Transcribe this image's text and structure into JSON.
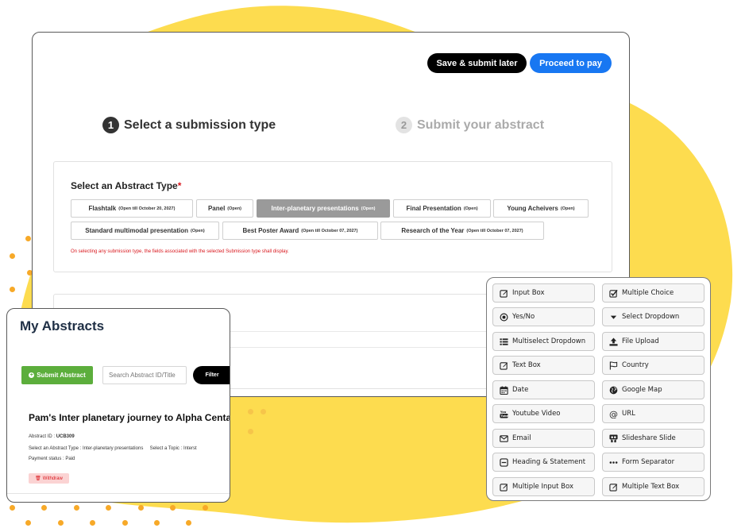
{
  "colors": {
    "accent_blue": "#1877f2",
    "submit_green": "#5cae3c",
    "required_red": "#d9181e",
    "blob_yellow": "#fddc4f"
  },
  "header": {
    "save_label": "Save & submit later",
    "pay_label": "Proceed to pay"
  },
  "steps": [
    {
      "number": "1",
      "label": "Select a submission type"
    },
    {
      "number": "2",
      "label": "Submit your abstract"
    }
  ],
  "abstract_type": {
    "title": "Select an Abstract Type",
    "required_mark": "*",
    "options": [
      {
        "label": "Flashtalk",
        "status": "(Open till October 20, 2027)"
      },
      {
        "label": "Panel",
        "status": "(Open)"
      },
      {
        "label": "Inter-planetary presentations",
        "status": "(Open)"
      },
      {
        "label": "Final Presentation",
        "status": "(Open)"
      },
      {
        "label": "Young Acheivers",
        "status": "(Open)"
      },
      {
        "label": "Standard multimodal presentation",
        "status": "(Open)"
      },
      {
        "label": "Best Poster Award",
        "status": "(Open till October 07, 2027)"
      },
      {
        "label": "Research of the Year",
        "status": "(Open till October 07, 2027)"
      }
    ],
    "note": "On selecting any submission type, the fields associated with the selected Submission type shall display."
  },
  "my_abstracts": {
    "title": "My Abstracts",
    "submit_label": "Submit Abstract",
    "search_placeholder": "Search Abstract ID/Title",
    "filter_label": "Filter",
    "item": {
      "title": "Pam's Inter planetary journey to Alpha Centauri",
      "id_label": "Abstract ID :",
      "id_value": "UCB309",
      "type_label": "Select an Abstract Type :",
      "type_value": "Inter-planetary presentations",
      "topic_label": "Select a Topic :",
      "topic_value": "Interst",
      "payment_label": "Payment status :",
      "payment_value": "Paid",
      "withdraw_label": "Withdraw"
    }
  },
  "field_types": [
    {
      "label": "Input Box",
      "icon": "edit-icon"
    },
    {
      "label": "Multiple Choice",
      "icon": "checkbox-icon"
    },
    {
      "label": "Yes/No",
      "icon": "radio-icon"
    },
    {
      "label": "Select Dropdown",
      "icon": "caret-down-icon"
    },
    {
      "label": "Multiselect Dropdown",
      "icon": "list-icon"
    },
    {
      "label": "File Upload",
      "icon": "upload-icon"
    },
    {
      "label": "Text Box",
      "icon": "edit-icon"
    },
    {
      "label": "Country",
      "icon": "flag-icon"
    },
    {
      "label": "Date",
      "icon": "calendar-icon"
    },
    {
      "label": "Google Map",
      "icon": "globe-icon"
    },
    {
      "label": "Youtube Video",
      "icon": "youtube-icon"
    },
    {
      "label": "URL",
      "icon": "at-icon"
    },
    {
      "label": "Email",
      "icon": "envelope-icon"
    },
    {
      "label": "Slideshare Slide",
      "icon": "slideshare-icon"
    },
    {
      "label": "Heading & Statement",
      "icon": "minus-square-icon"
    },
    {
      "label": "Form Separator",
      "icon": "ellipsis-icon"
    },
    {
      "label": "Multiple Input Box",
      "icon": "edit-icon"
    },
    {
      "label": "Multiple Text Box",
      "icon": "edit-icon"
    }
  ]
}
